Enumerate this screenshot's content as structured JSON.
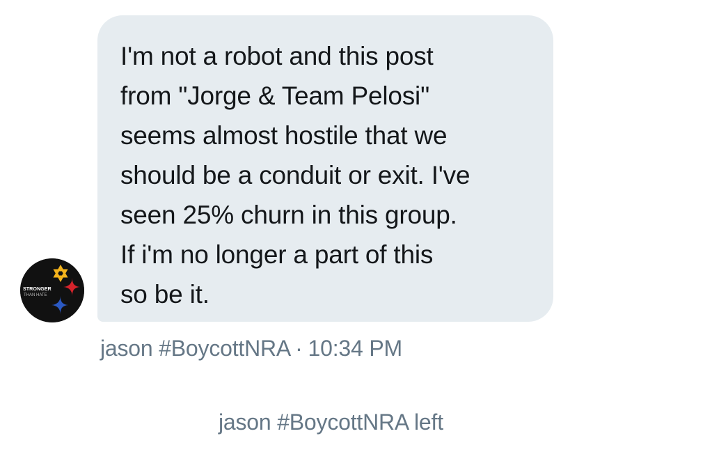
{
  "message": {
    "text": "I'm not a robot and this post\nfrom \"Jorge & Team Pelosi\"\nseems almost hostile that we\nshould be a conduit or exit. I've\nseen 25% churn in this group.\nIf i'm no longer a part of this\nso be it.",
    "sender": "jason #BoycottNRA",
    "separator": "·",
    "time": "10:34 PM"
  },
  "avatar": {
    "icon": "stronger-than-hate-logo",
    "line1": "STRONGER",
    "line2": "THAN HATE",
    "colors": {
      "background": "#111111",
      "star_of_david": "#f4b31c",
      "red_hypocycloid": "#d6232b",
      "blue_hypocycloid": "#2b59c3"
    }
  },
  "system_event": {
    "text": "jason #BoycottNRA left"
  },
  "colors": {
    "bubble": "#e6ecf0",
    "message_text": "#14171a",
    "meta_text": "#657786"
  }
}
